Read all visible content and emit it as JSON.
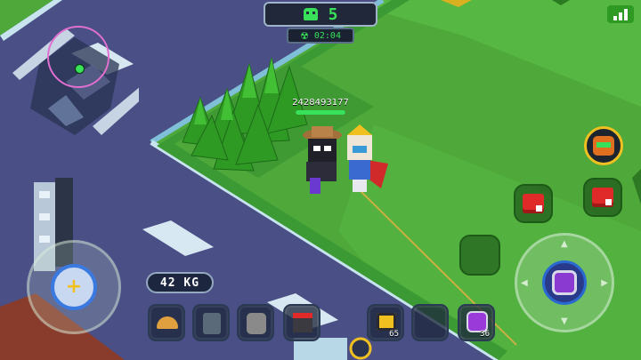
{
  "hud": {
    "alive_count": "5",
    "timer": "02:04",
    "player_id": "2428493177",
    "weight_label": "42 KG",
    "icons": {
      "alive": "skull-icon",
      "timer": "radiation-icon",
      "signal": "signal-icon",
      "move": "dpad-icon",
      "aim": "crosshair-icon"
    }
  },
  "inventory": {
    "slots": [
      {
        "name": "helmet-item",
        "count": ""
      },
      {
        "name": "armor-vest-item",
        "count": ""
      },
      {
        "name": "backpack-item",
        "count": ""
      },
      {
        "name": "turret-item",
        "count": ""
      },
      {
        "name": "ammo-crate-item",
        "count": "65"
      },
      {
        "name": "empty-slot",
        "count": ""
      },
      {
        "name": "drone-item",
        "count": "36"
      }
    ]
  },
  "colors": {
    "grass": "#4ea83a",
    "road": "#4a4f86",
    "accent_green": "#39e05a",
    "danger_red": "#e02a2a"
  }
}
